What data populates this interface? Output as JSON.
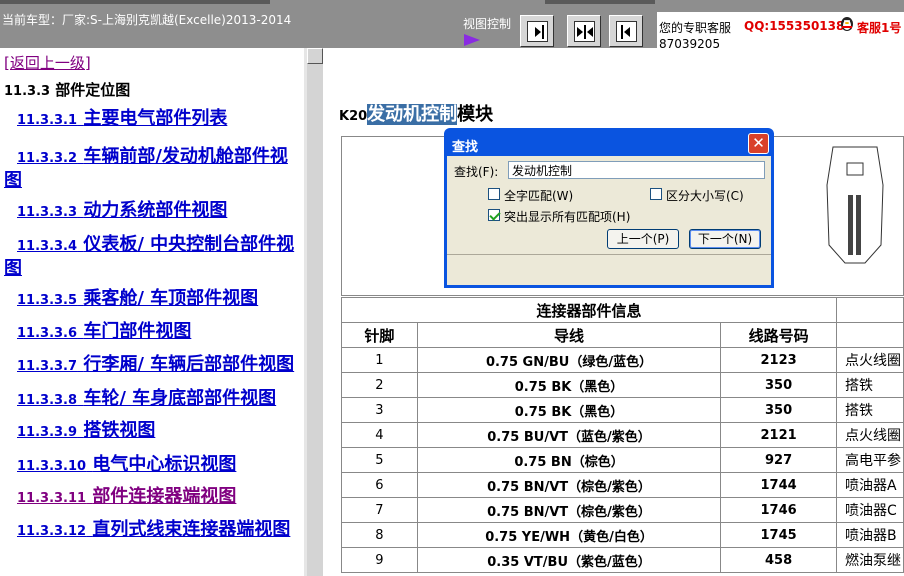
{
  "header": {
    "car_model": "当前车型：厂家:S-上海别克凯越(Excelle)2013-2014",
    "view_control_label": "视图控制",
    "service_text": "您的专职客服",
    "service_number_cont": "87039205",
    "qq": "QQ:1553501388",
    "service_name": "客服1号"
  },
  "sidebar": {
    "back_link": "[返回上一级]",
    "section_num": "11.3.3",
    "section_title": "部件定位图",
    "items": [
      {
        "num": "11.3.3.1",
        "label": "主要电气部件列表",
        "visited": false
      },
      {
        "num": "11.3.3.2",
        "label": "车辆前部/发动机舱部件视图",
        "visited": false
      },
      {
        "num": "11.3.3.3",
        "label": "动力系统部件视图",
        "visited": false
      },
      {
        "num": "11.3.3.4",
        "label": "仪表板/ 中央控制台部件视图",
        "visited": false
      },
      {
        "num": "11.3.3.5",
        "label": "乘客舱/ 车顶部件视图",
        "visited": false
      },
      {
        "num": "11.3.3.6",
        "label": "车门部件视图",
        "visited": false
      },
      {
        "num": "11.3.3.7",
        "label": "行李厢/ 车辆后部部件视图",
        "visited": false
      },
      {
        "num": "11.3.3.8",
        "label": "车轮/ 车身底部部件视图",
        "visited": false
      },
      {
        "num": "11.3.3.9",
        "label": "搭铁视图",
        "visited": false
      },
      {
        "num": "11.3.3.10",
        "label": "电气中心标识视图",
        "visited": false
      },
      {
        "num": "11.3.3.11",
        "label": "部件连接器端视图",
        "visited": true
      },
      {
        "num": "11.3.3.12",
        "label": "直列式线束连接器端视图",
        "visited": false
      }
    ]
  },
  "main": {
    "title_prefix": "K20",
    "title_highlight": "发动机控制",
    "title_suffix": "模块",
    "table_caption": "连接器部件信息",
    "columns": [
      "针脚",
      "导线",
      "线路号码",
      ""
    ],
    "rows": [
      {
        "pin": "1",
        "wire": "0.75 GN/BU（绿色/蓝色）",
        "circuit": "2123",
        "func": "点火线圈"
      },
      {
        "pin": "2",
        "wire": "0.75 BK（黑色）",
        "circuit": "350",
        "func": "搭铁"
      },
      {
        "pin": "3",
        "wire": "0.75 BK（黑色）",
        "circuit": "350",
        "func": "搭铁"
      },
      {
        "pin": "4",
        "wire": "0.75 BU/VT（蓝色/紫色）",
        "circuit": "2121",
        "func": "点火线圈"
      },
      {
        "pin": "5",
        "wire": "0.75 BN（棕色）",
        "circuit": "927",
        "func": "高电平参"
      },
      {
        "pin": "6",
        "wire": "0.75 BN/VT（棕色/紫色）",
        "circuit": "1744",
        "func": "喷油器A"
      },
      {
        "pin": "7",
        "wire": "0.75 BN/VT（棕色/紫色）",
        "circuit": "1746",
        "func": "喷油器C"
      },
      {
        "pin": "8",
        "wire": "0.75 YE/WH（黄色/白色）",
        "circuit": "1745",
        "func": "喷油器B"
      },
      {
        "pin": "9",
        "wire": "0.35 VT/BU（紫色/蓝色）",
        "circuit": "458",
        "func": "燃油泵继"
      }
    ]
  },
  "dialog": {
    "title": "查找",
    "find_label": "查找(F):",
    "find_value": "发动机控制",
    "opt_whole_word": "全字匹配(W)",
    "opt_match_case": "区分大小写(C)",
    "opt_highlight_all": "突出显示所有匹配项(H)",
    "whole_word_checked": false,
    "match_case_checked": false,
    "highlight_all_checked": true,
    "btn_prev": "上一个(P)",
    "btn_next": "下一个(N)"
  }
}
